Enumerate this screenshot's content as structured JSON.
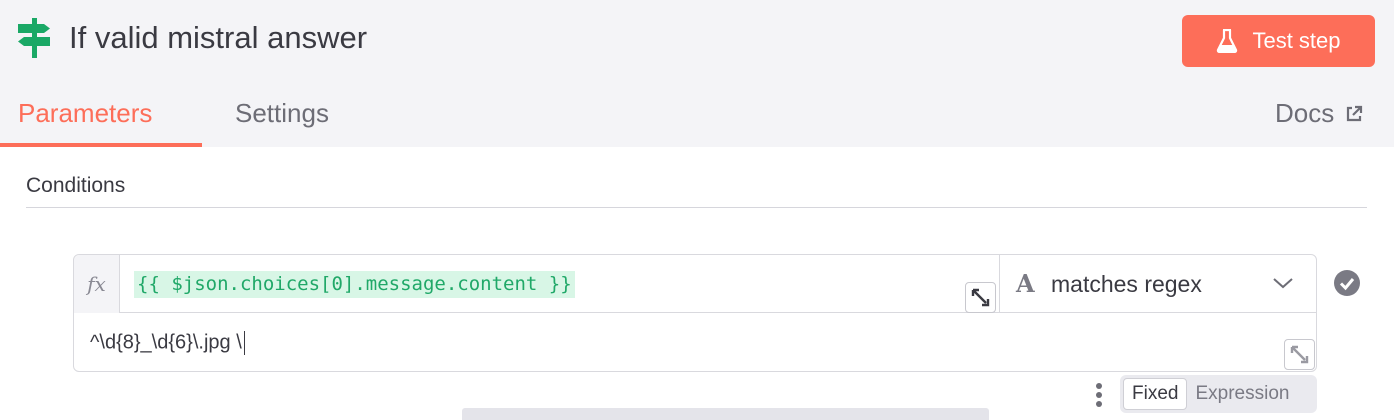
{
  "header": {
    "title": "If valid mistral answer",
    "test_button_label": "Test step",
    "colors": {
      "accent": "#fd6e59",
      "node_icon": "#1aa866",
      "header_bg": "#f4f4f7"
    }
  },
  "tabs": [
    {
      "label": "Parameters",
      "active": true
    },
    {
      "label": "Settings",
      "active": false
    }
  ],
  "docs_label": "Docs",
  "conditions": {
    "section_title": "Conditions",
    "rows": [
      {
        "fx_label": "fx",
        "left_value": "{{ $json.choices[0].message.content }}",
        "operator_type_glyph": "A",
        "operator": "matches regex",
        "right_value": "^\\d{8}_\\d{6}\\.jpg \\",
        "status": "check-circle-icon"
      }
    ]
  },
  "mode_toggle": {
    "fixed_label": "Fixed",
    "expression_label": "Expression",
    "selected": "Fixed"
  }
}
